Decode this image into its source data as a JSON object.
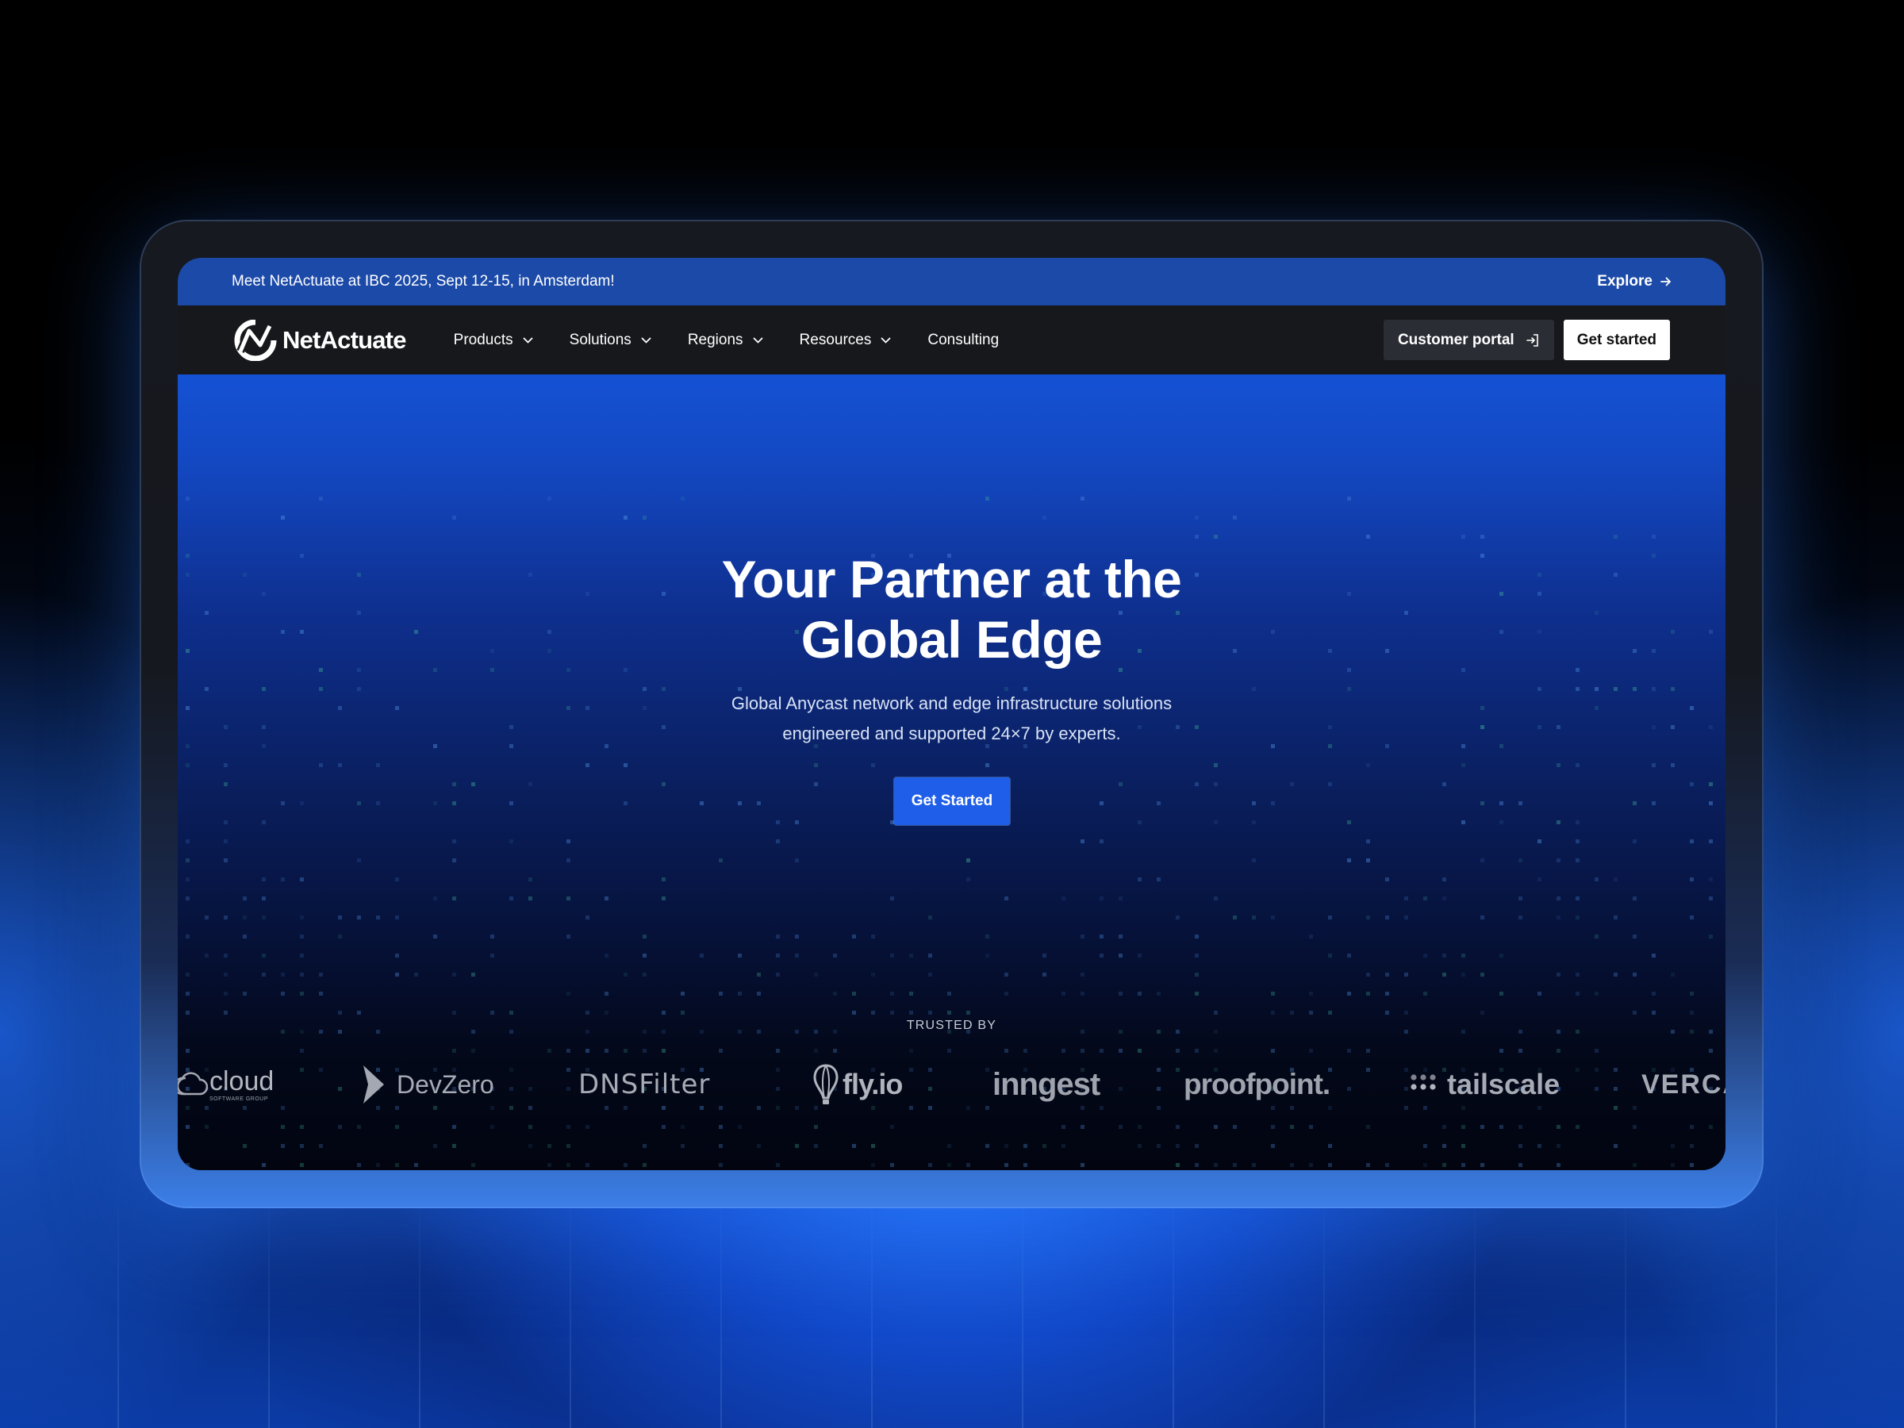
{
  "announcement": {
    "text": "Meet NetActuate at IBC 2025, Sept 12-15, in Amsterdam!",
    "explore_label": "Explore"
  },
  "nav": {
    "logo_text": "NetActuate",
    "menu": [
      {
        "label": "Products"
      },
      {
        "label": "Solutions"
      },
      {
        "label": "Regions"
      },
      {
        "label": "Resources"
      },
      {
        "label": "Consulting"
      }
    ],
    "portal_label": "Customer portal",
    "get_started_label": "Get started"
  },
  "hero": {
    "title_line1": "Your Partner at the",
    "title_line2": "Global Edge",
    "subtitle_line1": "Global Anycast network and edge infrastructure solutions",
    "subtitle_line2": "engineered and supported 24×7 by experts.",
    "cta_label": "Get Started"
  },
  "trusted": {
    "heading": "TRUSTED BY",
    "logos": {
      "cloud": "cloud",
      "cloud_sub": "SOFTWARE GROUP",
      "devzero": "DevZero",
      "dnsfilter": "DNSFilter",
      "flyio": "fly.io",
      "inngest": "inngest",
      "proofpoint": "proofpoint.",
      "tailscale": "tailscale",
      "vercel": "VERCA"
    }
  },
  "colors": {
    "accent": "#1f5ee8",
    "announcement_bg": "#1c4aa8",
    "nav_bg": "#16181c"
  }
}
